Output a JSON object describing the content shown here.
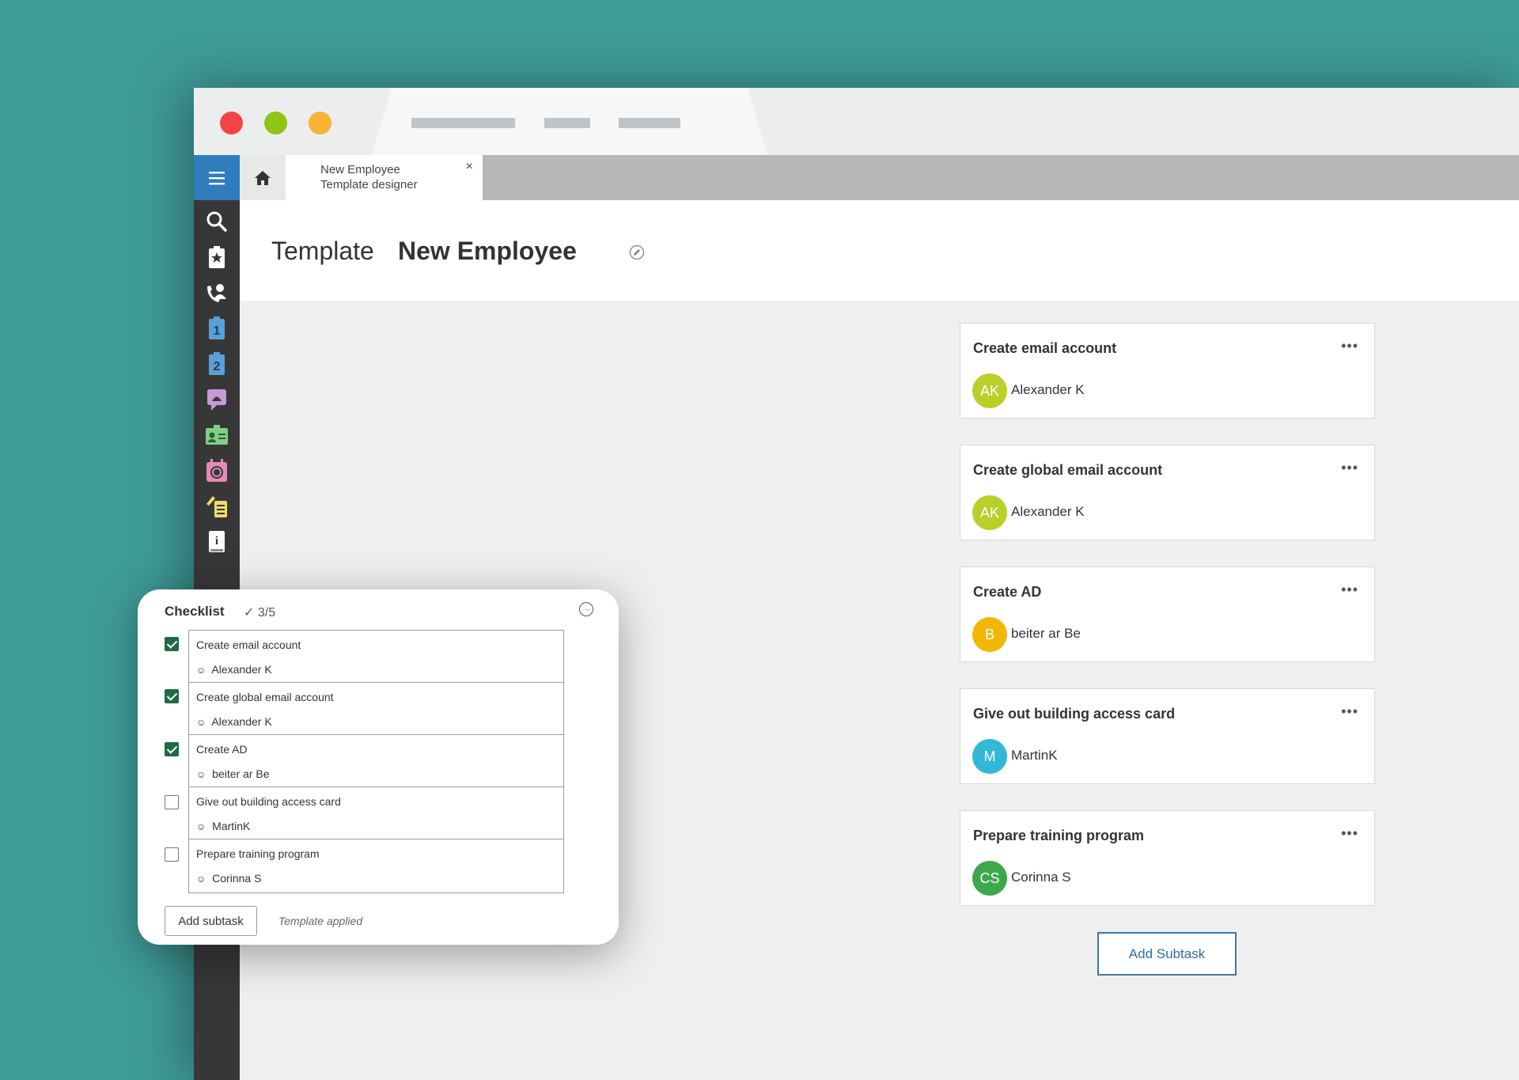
{
  "colors": {
    "background": "#3f9b98",
    "menu_button": "#2f7dbd",
    "sidebar": "#373737",
    "checkbox_checked": "#1e6b43",
    "add_subtask_border": "#3a78ab",
    "traffic_red": "#f24444",
    "traffic_green": "#8ec414",
    "traffic_yellow": "#f7b334"
  },
  "tabs": {
    "home_icon": "home-icon",
    "active_tab_line1": "New Employee",
    "active_tab_line2": "Template designer",
    "close_label": "×"
  },
  "sidebar": {
    "menu_icon": "hamburger-icon",
    "items": [
      "search-icon",
      "favorites-icon",
      "contacts-icon",
      "level-1-icon",
      "level-2-icon",
      "chat-icon",
      "id-card-icon",
      "calendar-icon",
      "tasks-icon",
      "info-icon"
    ]
  },
  "header": {
    "label": "Template",
    "name": "New Employee",
    "edit_icon": "edit-icon"
  },
  "cards": [
    {
      "title": "Create email account",
      "initials": "AK",
      "assignee": "Alexander K",
      "color": "#b9cf2a"
    },
    {
      "title": "Create global email account",
      "initials": "AK",
      "assignee": "Alexander K",
      "color": "#b9cf2a"
    },
    {
      "title": "Create AD",
      "initials": "B",
      "assignee": "beiter ar Be",
      "color": "#f2b705"
    },
    {
      "title": "Give out building access card",
      "initials": "M",
      "assignee": "MartinK",
      "color": "#31b8d6"
    },
    {
      "title": "Prepare training program",
      "initials": "CS",
      "assignee": "Corinna S",
      "color": "#3ca84b"
    }
  ],
  "more_label": "•••",
  "add_subtask_label": "Add Subtask",
  "checklist": {
    "title": "Checklist",
    "count": "✓ 3/5",
    "more_label": "···",
    "items": [
      {
        "title": "Create email account",
        "assignee": "Alexander K",
        "checked": true
      },
      {
        "title": "Create global email account",
        "assignee": "Alexander K",
        "checked": true
      },
      {
        "title": "Create AD",
        "assignee": "beiter ar Be",
        "checked": true
      },
      {
        "title": "Give out building access card",
        "assignee": "MartinK",
        "checked": false
      },
      {
        "title": "Prepare training program",
        "assignee": "Corinna S",
        "checked": false
      }
    ],
    "add_label": "Add subtask",
    "status": "Template applied"
  }
}
